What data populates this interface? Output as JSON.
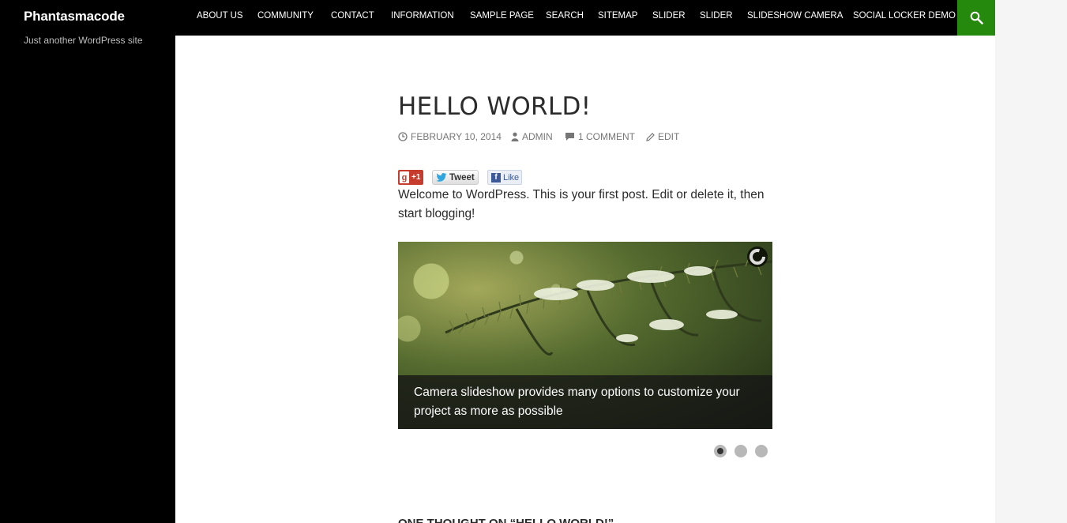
{
  "site": {
    "title": "Phantasmacode",
    "description": "Just another WordPress site"
  },
  "nav": {
    "items": [
      {
        "label": "ABOUT US"
      },
      {
        "label": "COMMUNITY"
      },
      {
        "label": "CONTACT"
      },
      {
        "label": "INFORMATION"
      },
      {
        "label": "SAMPLE PAGE"
      },
      {
        "label": "SEARCH"
      },
      {
        "label": "SITEMAP"
      },
      {
        "label": "SLIDER"
      },
      {
        "label": "SLIDER"
      },
      {
        "label": "SLIDESHOW CAMERA"
      },
      {
        "label": "SOCIAL LOCKER DEMO"
      }
    ],
    "search_icon": "search-icon",
    "accent_color": "#24890d"
  },
  "post": {
    "title": "HELLO WORLD!",
    "meta": {
      "date": "FEBRUARY 10, 2014",
      "author": "ADMIN",
      "comments": "1 COMMENT",
      "edit": "EDIT"
    },
    "share": {
      "gplus": "+1",
      "tweet": "Tweet",
      "like": "Like"
    },
    "intro": "Welcome to WordPress. This is your first post. Edit or delete it, then start blogging!",
    "slideshow": {
      "caption": "Camera slideshow provides many options to customize your project as more as possible",
      "slide_count": 3,
      "active_slide": 1
    },
    "comments_title": "ONE THOUGHT ON “HELLO WORLD!”"
  }
}
